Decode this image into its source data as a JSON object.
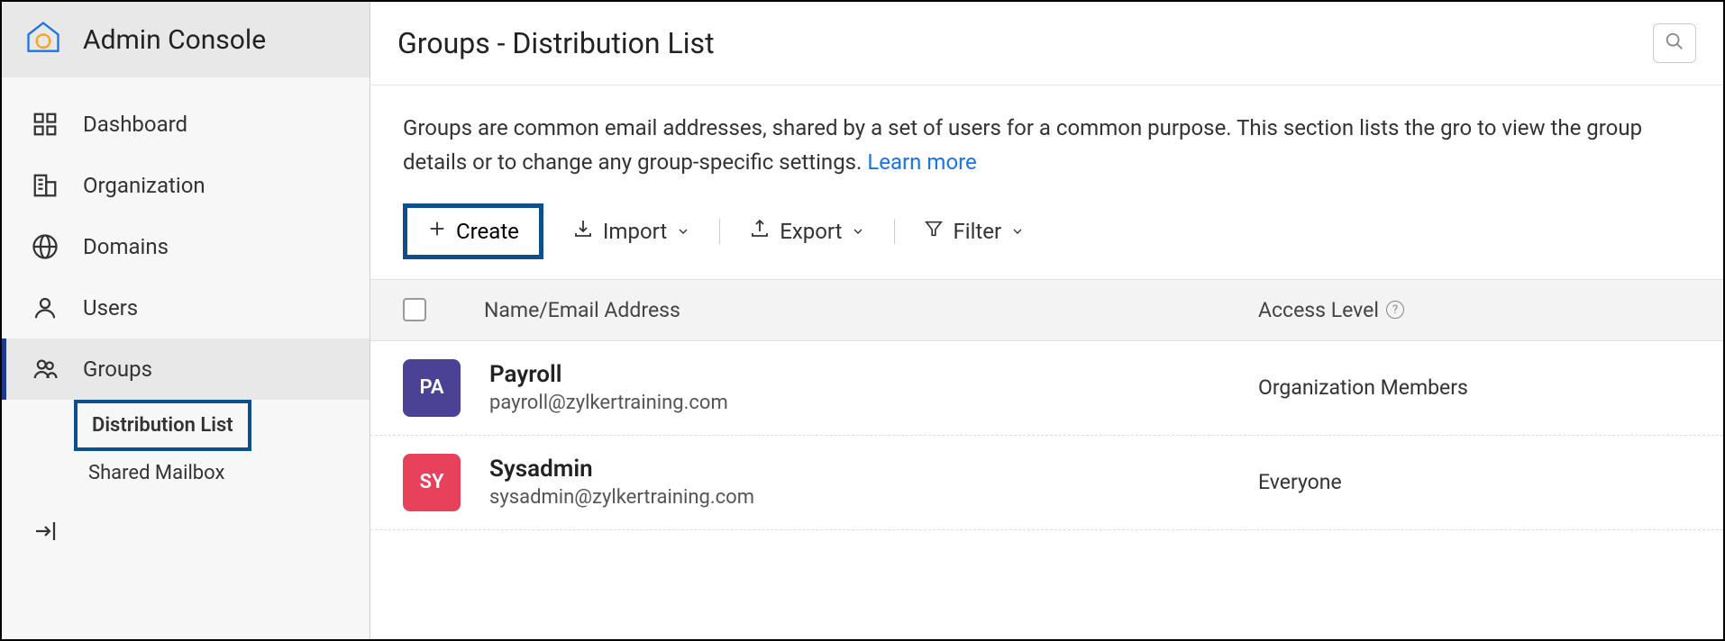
{
  "sidebar": {
    "title": "Admin Console",
    "items": [
      {
        "label": "Dashboard"
      },
      {
        "label": "Organization"
      },
      {
        "label": "Domains"
      },
      {
        "label": "Users"
      },
      {
        "label": "Groups"
      }
    ],
    "sub_items": [
      {
        "label": "Distribution List"
      },
      {
        "label": "Shared Mailbox"
      }
    ]
  },
  "header": {
    "title": "Groups - Distribution List"
  },
  "description": {
    "text": "Groups are common email addresses, shared by a set of users for a common purpose. This section lists the gro to view the group details or to change any group-specific settings.  ",
    "learn_more": "Learn more"
  },
  "toolbar": {
    "create": "Create",
    "import": "Import",
    "export": "Export",
    "filter": "Filter"
  },
  "table": {
    "headers": {
      "name": "Name/Email Address",
      "access": "Access Level"
    },
    "rows": [
      {
        "avatar_text": "PA",
        "avatar_color": "#4b4296",
        "name": "Payroll",
        "email": "payroll@zylkertraining.com",
        "access": "Organization Members"
      },
      {
        "avatar_text": "SY",
        "avatar_color": "#e8415c",
        "name": "Sysadmin",
        "email": "sysadmin@zylkertraining.com",
        "access": "Everyone"
      }
    ]
  }
}
